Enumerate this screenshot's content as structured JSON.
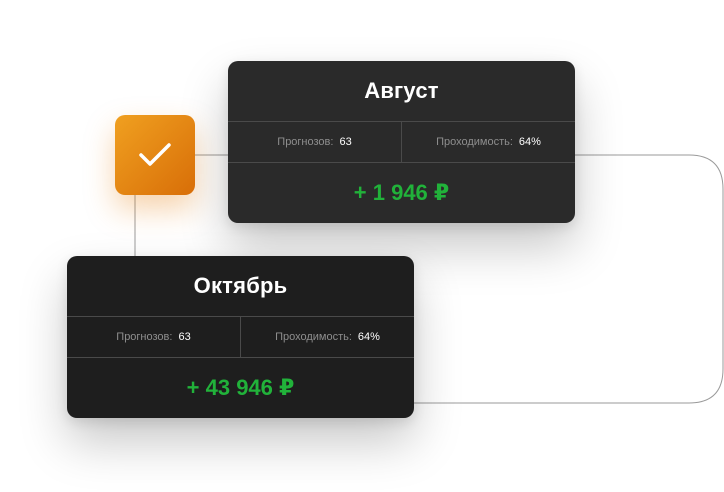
{
  "colors": {
    "amount_green": "#21b23a",
    "badge_orange": "#ef9a1f",
    "connector_line": "#9a9a9a"
  },
  "badge": {
    "icon": "check-icon"
  },
  "cards": [
    {
      "title": "Август",
      "forecasts_label": "Прогнозов:",
      "forecasts_value": "63",
      "passability_label": "Проходимость:",
      "passability_value": "64%",
      "amount": "+ 1 946 ₽"
    },
    {
      "title": "Октябрь",
      "forecasts_label": "Прогнозов:",
      "forecasts_value": "63",
      "passability_label": "Проходимость:",
      "passability_value": "64%",
      "amount": "+ 43 946 ₽"
    }
  ]
}
